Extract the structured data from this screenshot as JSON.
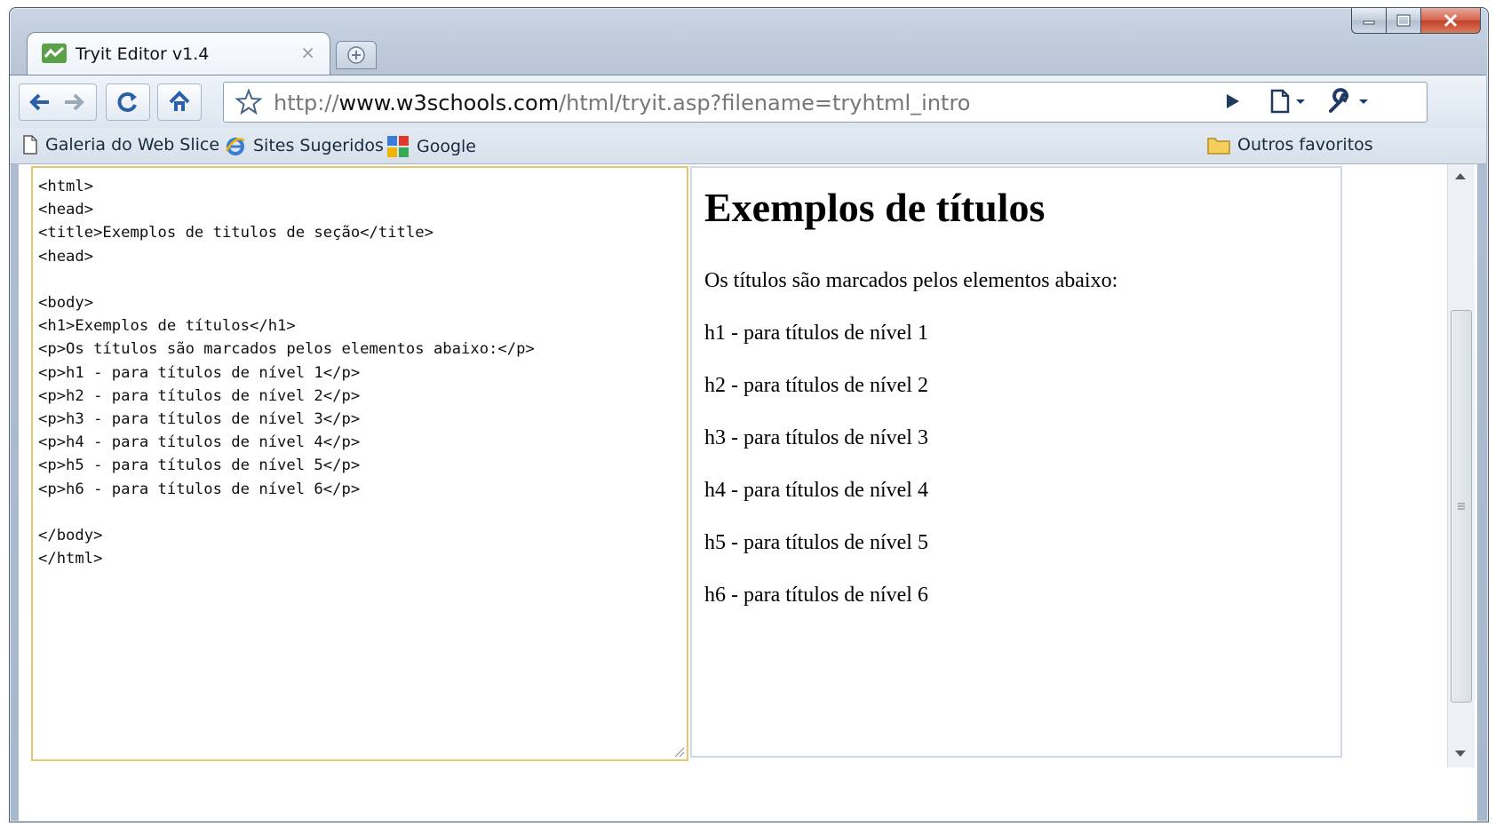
{
  "tab": {
    "title": "Tryit Editor v1.4",
    "favicon_label": "Tryit",
    "close": "×"
  },
  "window_controls": {
    "minimize": "–",
    "maximize": "□",
    "close": "×"
  },
  "omnibox": {
    "scheme": "http://",
    "host": "www.w3schools.com",
    "path": "/html/tryit.asp?filename=tryhtml_intro"
  },
  "bookmarks": {
    "items": [
      {
        "label": "Galeria do Web Slice",
        "icon": "page-icon"
      },
      {
        "label": "Sites Sugeridos",
        "icon": "ie-icon"
      },
      {
        "label": "Google",
        "icon": "google-icon"
      }
    ],
    "other": {
      "label": "Outros favoritos",
      "icon": "folder-icon"
    }
  },
  "editor": {
    "code": "<html>\n<head>\n<title>Exemplos de titulos de seção</title>\n<head>\n\n<body>\n<h1>Exemplos de títulos</h1>\n<p>Os títulos são marcados pelos elementos abaixo:</p>\n<p>h1 - para títulos de nível 1</p>\n<p>h2 - para títulos de nível 2</p>\n<p>h3 - para títulos de nível 3</p>\n<p>h4 - para títulos de nível 4</p>\n<p>h5 - para títulos de nível 5</p>\n<p>h6 - para títulos de nível 6</p>\n\n</body>\n</html>"
  },
  "preview": {
    "heading": "Exemplos de títulos",
    "paragraphs": [
      "Os títulos são marcados pelos elementos abaixo:",
      "h1 - para títulos de nível 1",
      "h2 - para títulos de nível 2",
      "h3 - para títulos de nível 3",
      "h4 - para títulos de nível 4",
      "h5 - para títulos de nível 5",
      "h6 - para títulos de nível 6"
    ]
  },
  "colors": {
    "accent_chrome": "#c9d5e3",
    "editor_border": "#e5c86e",
    "close_button": "#c2412b"
  }
}
